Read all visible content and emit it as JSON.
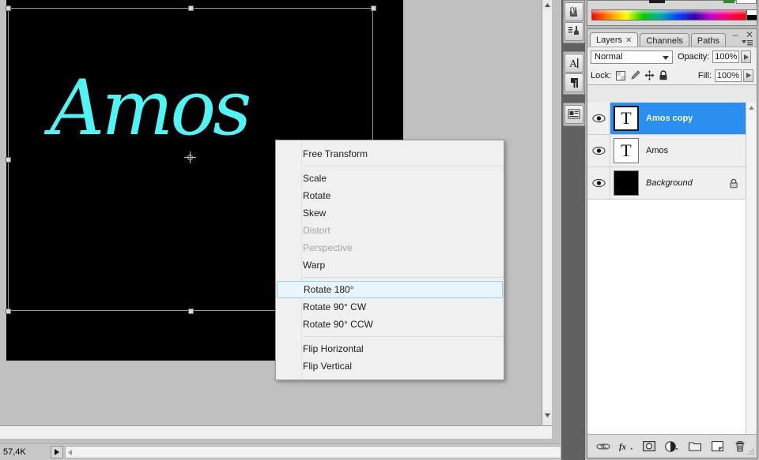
{
  "document": {
    "status_size": "57,4K",
    "canvas_text": "Amos",
    "text_color": "#4ff4f4",
    "canvas_bg": "#000000",
    "workspace_bg": "#c0c0c0"
  },
  "context_menu": {
    "items": [
      {
        "label": "Free Transform",
        "state": "normal"
      },
      {
        "label": "__sep__",
        "state": "separator"
      },
      {
        "label": "Scale",
        "state": "normal"
      },
      {
        "label": "Rotate",
        "state": "normal"
      },
      {
        "label": "Skew",
        "state": "normal"
      },
      {
        "label": "Distort",
        "state": "disabled"
      },
      {
        "label": "Perspective",
        "state": "disabled"
      },
      {
        "label": "Warp",
        "state": "normal"
      },
      {
        "label": "__sep__",
        "state": "separator"
      },
      {
        "label": "Rotate 180°",
        "state": "highlighted"
      },
      {
        "label": "Rotate 90° CW",
        "state": "normal"
      },
      {
        "label": "Rotate 90° CCW",
        "state": "normal"
      },
      {
        "label": "__sep__",
        "state": "separator"
      },
      {
        "label": "Flip Horizontal",
        "state": "normal"
      },
      {
        "label": "Flip Vertical",
        "state": "normal"
      }
    ],
    "highlight_fill": "#eaf4fb",
    "highlight_border": "#9ecbe8"
  },
  "icon_dock": {
    "groups": [
      {
        "icons": [
          "brush-presets-icon",
          "tool-presets-icon"
        ]
      },
      {
        "icons": [
          "character-icon",
          "paragraph-icon"
        ]
      },
      {
        "icons": [
          "info-panel-icon"
        ]
      }
    ]
  },
  "color_panel": {
    "name": "color-ramp-panel",
    "ramp": "spectrum",
    "foreground": "#1c1c1c",
    "background": "#ffffff"
  },
  "layers_panel": {
    "tabs": [
      {
        "label": "Layers",
        "active": true,
        "closable": true
      },
      {
        "label": "Channels",
        "active": false,
        "closable": false
      },
      {
        "label": "Paths",
        "active": false,
        "closable": false
      }
    ],
    "blend_mode": "Normal",
    "opacity_label": "Opacity:",
    "opacity_value": "100%",
    "lock_label": "Lock:",
    "lock_icons": [
      "lock-transparency-icon",
      "lock-image-icon",
      "lock-position-icon",
      "lock-all-icon"
    ],
    "fill_label": "Fill:",
    "fill_value": "100%",
    "selected_color": "#2a8fef",
    "layers": [
      {
        "name": "Amos copy",
        "thumb_type": "text",
        "thumb_glyph": "T",
        "visible": true,
        "selected": true,
        "locked": false,
        "italic": false
      },
      {
        "name": "Amos",
        "thumb_type": "text",
        "thumb_glyph": "T",
        "visible": true,
        "selected": false,
        "locked": false,
        "italic": false
      },
      {
        "name": "Background",
        "thumb_type": "solid",
        "thumb_glyph": "",
        "visible": true,
        "selected": false,
        "locked": true,
        "italic": true
      }
    ],
    "footer_buttons": [
      "link-layers-icon",
      "layer-style-fx-icon",
      "add-layer-mask-icon",
      "new-adjustment-layer-icon",
      "new-group-icon",
      "new-layer-icon",
      "delete-layer-icon"
    ],
    "window_buttons": [
      "minimize-icon",
      "close-icon",
      "panel-menu-icon"
    ]
  }
}
